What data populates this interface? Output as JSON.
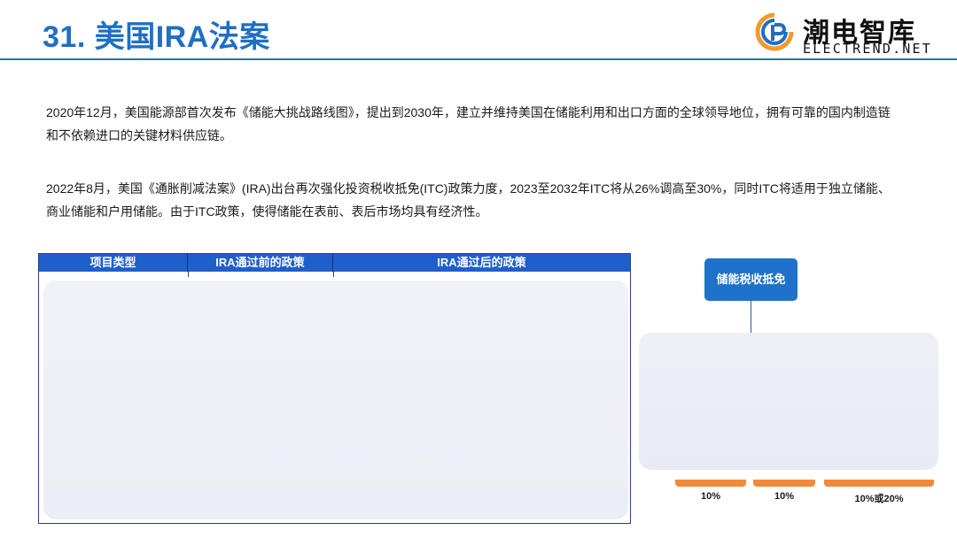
{
  "header": {
    "title": "31. 美国IRA法案",
    "logo_cn": "潮电智库",
    "logo_en": "ELECTREND.NET",
    "accent_color": "#1f6fc4"
  },
  "body": {
    "paragraph_1": "2020年12月，美国能源部首次发布《储能大挑战路线图》，提出到2030年，建立并维持美国在储能利用和出口方面的全球领导地位，拥有可靠的国内制造链和不依赖进口的关键材料供应链。",
    "paragraph_2": "2022年8月，美国《通胀削减法案》(IRA)出台再次强化投资税收抵免(ITC)政策力度，2023至2032年ITC将从26%调高至30%，同时ITC将适用于独立储能、商业储能和户用储能。由于ITC政策，使得储能在表前、表后市场均具有经济性。"
  },
  "table": {
    "headers": [
      "项目类型",
      "IRA通过前的政策",
      "IRA通过后的政策"
    ],
    "header_color": "#1f5fc9"
  },
  "diagram": {
    "root_label": "储能税收抵免",
    "rates": [
      "10%",
      "10%",
      "10%或20%"
    ],
    "bar_color": "#f08a3a"
  }
}
